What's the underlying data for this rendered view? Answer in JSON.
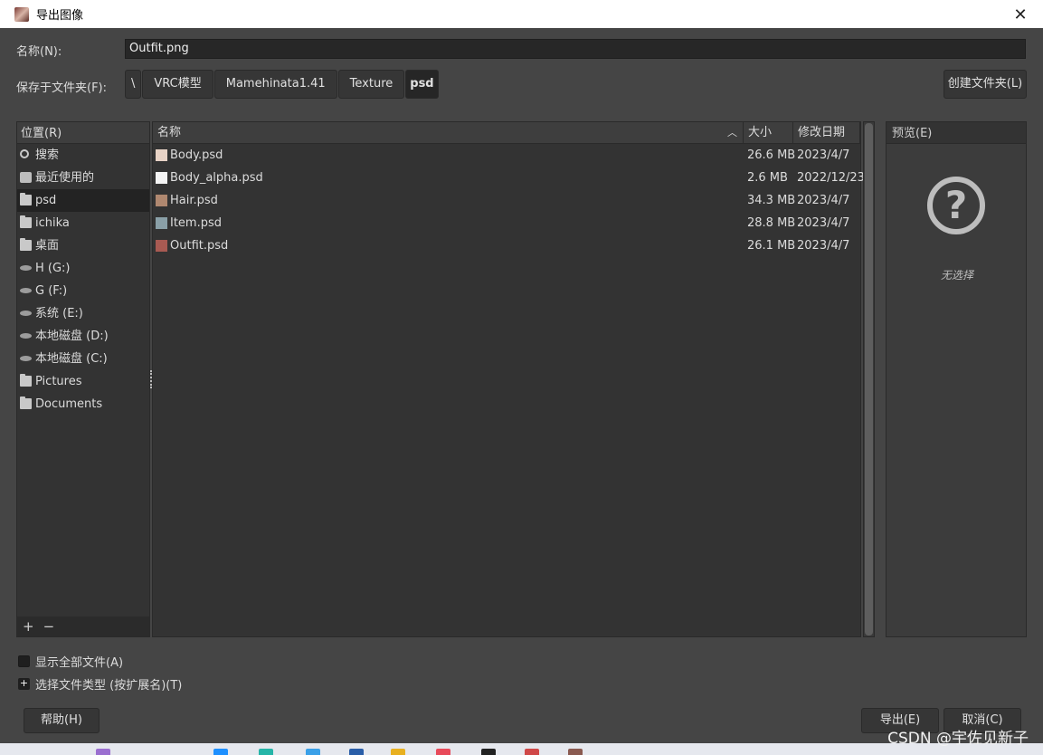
{
  "window": {
    "title": "导出图像"
  },
  "form": {
    "name_label": "名称(N):",
    "name_value": "Outfit.png",
    "save_in_label": "保存于文件夹(F):",
    "breadcrumb": [
      "\\",
      "VRC模型",
      "Mamehinata1.41",
      "Texture",
      "psd"
    ],
    "create_folder": "创建文件夹(L)"
  },
  "places": {
    "header": "位置(R)",
    "items": [
      {
        "label": "搜索",
        "icon": "search-icon"
      },
      {
        "label": "最近使用的",
        "icon": "recent-icon"
      },
      {
        "label": "psd",
        "icon": "folder-icon",
        "selected": true
      },
      {
        "label": "ichika",
        "icon": "folder-icon"
      },
      {
        "label": "桌面",
        "icon": "folder-icon"
      },
      {
        "label": "H (G:)",
        "icon": "drive-icon"
      },
      {
        "label": "G (F:)",
        "icon": "drive-icon"
      },
      {
        "label": "系统 (E:)",
        "icon": "drive-icon"
      },
      {
        "label": "本地磁盘 (D:)",
        "icon": "drive-icon"
      },
      {
        "label": "本地磁盘 (C:)",
        "icon": "drive-icon"
      },
      {
        "label": "Pictures",
        "icon": "folder-icon"
      },
      {
        "label": "Documents",
        "icon": "folder-icon"
      }
    ],
    "add": "+",
    "remove": "−"
  },
  "files": {
    "columns": {
      "name": "名称",
      "size": "大小",
      "date": "修改日期"
    },
    "sort_arrow": "︿",
    "rows": [
      {
        "name": "Body.psd",
        "size": "26.6 MB",
        "date": "2023/4/7",
        "thumb": "#e8d3c6"
      },
      {
        "name": "Body_alpha.psd",
        "size": "2.6 MB",
        "date": "2022/12/23",
        "thumb": "#f4f4f4"
      },
      {
        "name": "Hair.psd",
        "size": "34.3 MB",
        "date": "2023/4/7",
        "thumb": "#b08870"
      },
      {
        "name": "Item.psd",
        "size": "28.8 MB",
        "date": "2023/4/7",
        "thumb": "#8aa0a8"
      },
      {
        "name": "Outfit.psd",
        "size": "26.1 MB",
        "date": "2023/4/7",
        "thumb": "#a85a52"
      }
    ]
  },
  "preview": {
    "header": "预览(E)",
    "empty_text": "无选择",
    "icon_glyph": "?"
  },
  "options": {
    "show_all": "显示全部文件(A)",
    "file_type": "选择文件类型 (按扩展名)(T)",
    "expander_glyph": "+"
  },
  "buttons": {
    "help": "帮助(H)",
    "export": "导出(E)",
    "cancel": "取消(C)"
  },
  "watermark": "CSDN @宇佐见新子",
  "close_glyph": "✕"
}
